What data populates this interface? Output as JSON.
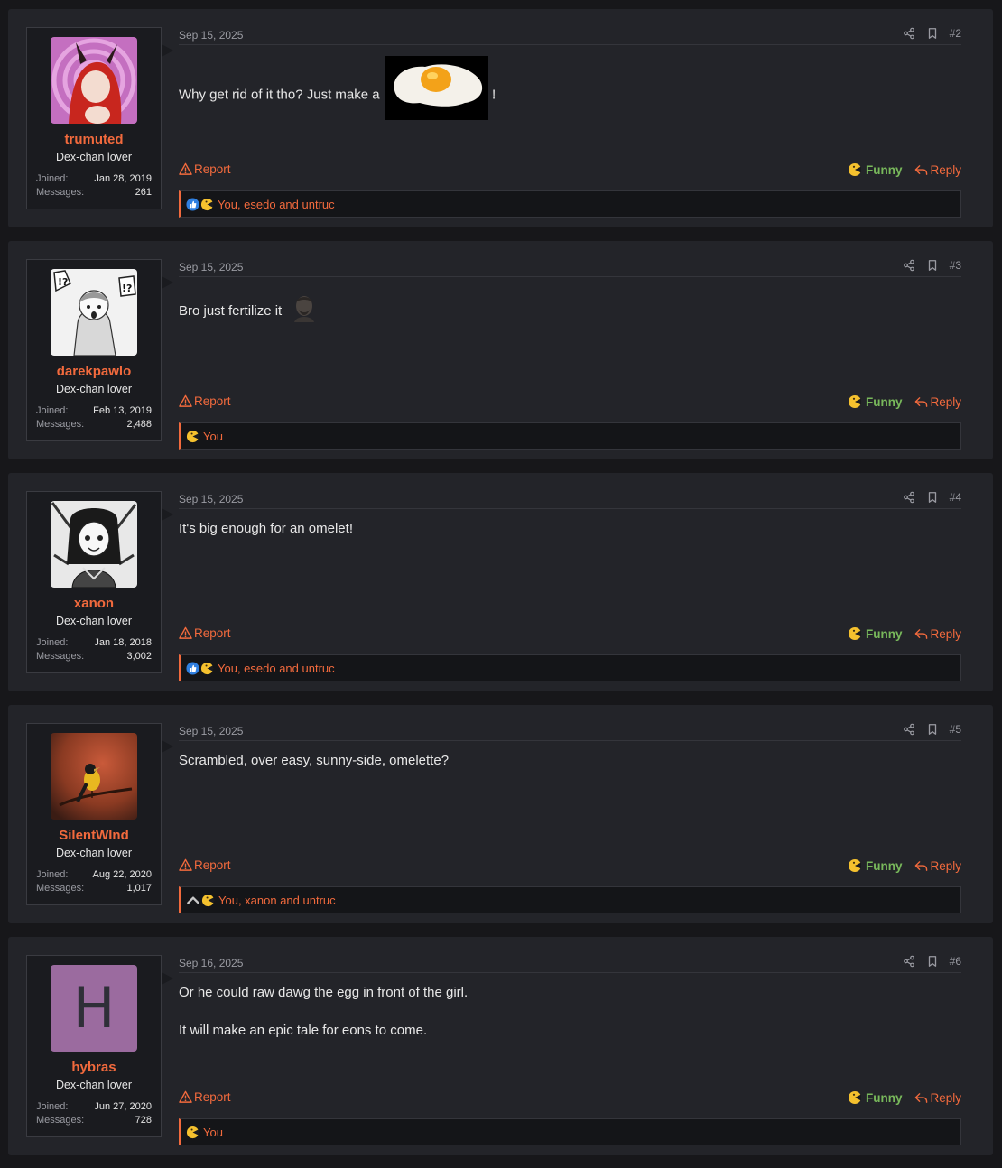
{
  "posts": [
    {
      "username": "trumuted",
      "user_title": "Dex-chan lover",
      "joined_label": "Joined:",
      "joined": "Jan 28, 2019",
      "messages_label": "Messages:",
      "messages": "261",
      "date": "Sep 15, 2025",
      "post_number": "#2",
      "content_before": "Why get rid of it tho? Just make a",
      "content_after": "!",
      "report_label": "Report",
      "funny_label": "Funny",
      "reply_label": "Reply",
      "reactions_text": "You, esedo and untruc",
      "reaction_icons": [
        "like-icon",
        "funny-icon"
      ]
    },
    {
      "username": "darekpawlo",
      "user_title": "Dex-chan lover",
      "joined_label": "Joined:",
      "joined": "Feb 13, 2019",
      "messages_label": "Messages:",
      "messages": "2,488",
      "date": "Sep 15, 2025",
      "post_number": "#3",
      "content": "Bro just fertilize it",
      "report_label": "Report",
      "funny_label": "Funny",
      "reply_label": "Reply",
      "reactions_text": "You",
      "reaction_icons": [
        "funny-icon"
      ]
    },
    {
      "username": "xanon",
      "user_title": "Dex-chan lover",
      "joined_label": "Joined:",
      "joined": "Jan 18, 2018",
      "messages_label": "Messages:",
      "messages": "3,002",
      "date": "Sep 15, 2025",
      "post_number": "#4",
      "content": "It's big enough for an omelet!",
      "report_label": "Report",
      "funny_label": "Funny",
      "reply_label": "Reply",
      "reactions_text": "You, esedo and untruc",
      "reaction_icons": [
        "like-icon",
        "funny-icon"
      ]
    },
    {
      "username": "SilentWInd",
      "user_title": "Dex-chan lover",
      "joined_label": "Joined:",
      "joined": "Aug 22, 2020",
      "messages_label": "Messages:",
      "messages": "1,017",
      "date": "Sep 15, 2025",
      "post_number": "#5",
      "content": "Scrambled, over easy, sunny-side, omelette?",
      "report_label": "Report",
      "funny_label": "Funny",
      "reply_label": "Reply",
      "reactions_text": "You, xanon and untruc",
      "reaction_icons": [
        "upvote-icon",
        "funny-icon"
      ]
    },
    {
      "username": "hybras",
      "avatar_letter": "H",
      "user_title": "Dex-chan lover",
      "joined_label": "Joined:",
      "joined": "Jun 27, 2020",
      "messages_label": "Messages:",
      "messages": "728",
      "date": "Sep 16, 2025",
      "post_number": "#6",
      "content_lines": [
        "Or he could raw dawg the egg in front of the girl.",
        "It will make an epic tale for eons to come."
      ],
      "report_label": "Report",
      "funny_label": "Funny",
      "reply_label": "Reply",
      "reactions_text": "You",
      "reaction_icons": [
        "funny-icon"
      ]
    }
  ],
  "colors": {
    "accent": "#f26a3d",
    "funny": "#78b85b",
    "post_bg": "#232429",
    "page_bg": "#17171a"
  }
}
